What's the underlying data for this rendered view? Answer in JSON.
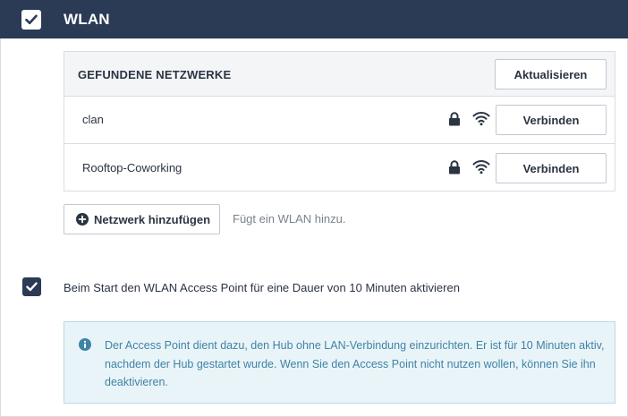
{
  "header": {
    "title": "WLAN",
    "checked": true
  },
  "networks": {
    "section_label": "GEFUNDENE NETZWERKE",
    "refresh_label": "Aktualisieren",
    "items": [
      {
        "name": "clan",
        "secured": true,
        "connect_label": "Verbinden"
      },
      {
        "name": "Rooftop-Coworking",
        "secured": true,
        "connect_label": "Verbinden"
      }
    ]
  },
  "add_network": {
    "label": "Netzwerk hinzufügen",
    "hint": "Fügt ein WLAN hinzu."
  },
  "access_point": {
    "checked": true,
    "label": "Beim Start den WLAN Access Point für eine Dauer von 10 Minuten aktivieren"
  },
  "info": {
    "text": "Der Access Point dient dazu, den Hub ohne LAN-Verbindung einzurichten. Er ist für 10 Minuten aktiv, nachdem der Hub gestartet wurde. Wenn Sie den Access Point nicht nutzen wollen, können Sie ihn deaktivieren."
  },
  "colors": {
    "header_bg": "#2b3a55",
    "info_bg": "#e9f4f8",
    "info_text": "#3f83a6"
  },
  "icons": [
    "check-icon",
    "lock-icon",
    "wifi-icon",
    "plus-circle-icon",
    "info-icon"
  ]
}
